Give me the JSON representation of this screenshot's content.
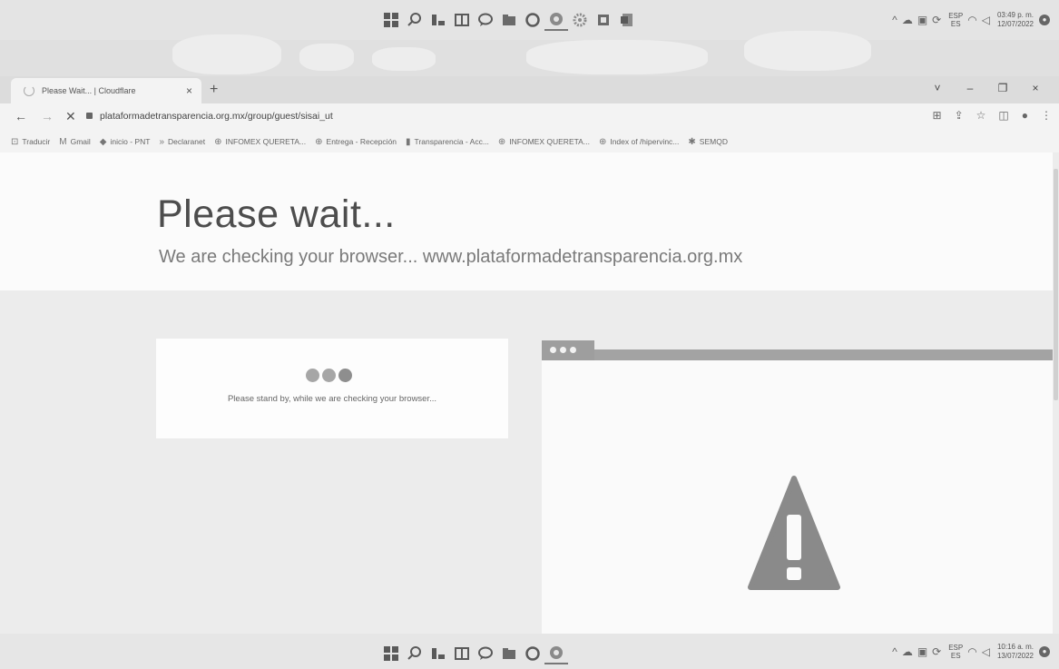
{
  "top_taskbar": {
    "language": {
      "code": "ESP",
      "sub": "ES"
    },
    "clock": {
      "time": "03:49 p. m.",
      "date": "12/07/2022"
    }
  },
  "browser": {
    "tab": {
      "title": "Please Wait... | Cloudflare",
      "close": "×"
    },
    "new_tab": "+",
    "window_controls": [
      "˅",
      "–",
      "❐",
      "×"
    ],
    "url": "plataformadetransparencia.org.mx/group/guest/sisai_ut",
    "bookmarks": [
      {
        "icon": "translate-icon",
        "label": "Traducir"
      },
      {
        "icon": "gmail-icon",
        "label": "Gmail"
      },
      {
        "icon": "pnt-icon",
        "label": "inicio - PNT"
      },
      {
        "icon": "declaranet-icon",
        "label": "Declaranet"
      },
      {
        "icon": "globe-icon",
        "label": "INFOMEX QUERETA..."
      },
      {
        "icon": "globe-icon",
        "label": "Entrega - Recepción"
      },
      {
        "icon": "transparencia-icon",
        "label": "Transparencia - Acc..."
      },
      {
        "icon": "globe-icon",
        "label": "INFOMEX QUERETA..."
      },
      {
        "icon": "globe-icon",
        "label": "Index of /hipervinc..."
      },
      {
        "icon": "semqd-icon",
        "label": "SEMQD"
      }
    ]
  },
  "page": {
    "heading": "Please wait...",
    "subheading": "We are checking your browser... www.plataformadetransparencia.org.mx",
    "standby_text": "Please stand by, while we are checking your browser..."
  },
  "bottom_taskbar": {
    "language": {
      "code": "ESP",
      "sub": "ES"
    },
    "clock": {
      "time": "10:16 a. m.",
      "date": "13/07/2022"
    }
  },
  "colors": {
    "warning_triangle": "#8a8a8a",
    "illustration_bar": "#a3a3a3",
    "standby_dots": "#a6a6a6"
  }
}
